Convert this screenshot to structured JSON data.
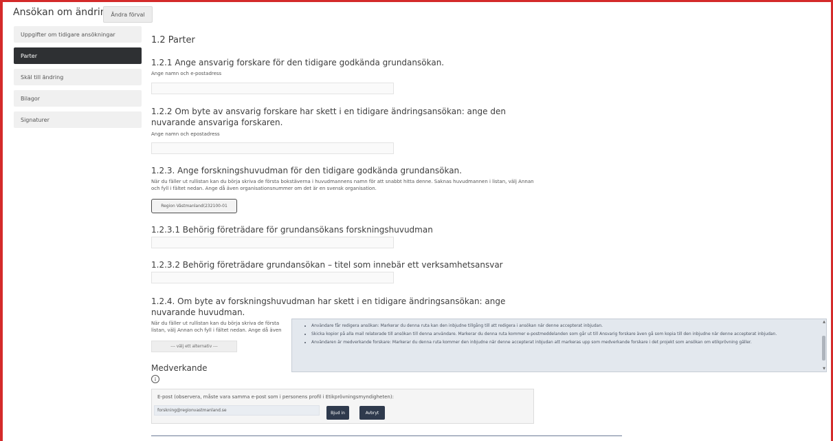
{
  "header": {
    "title": "Ansökan om ändring",
    "change_button": "Ändra förval"
  },
  "sidebar": {
    "items": [
      {
        "label": "Uppgifter om tidigare ansökningar"
      },
      {
        "label": "Parter"
      },
      {
        "label": "Skäl till ändring"
      },
      {
        "label": "Bilagor"
      },
      {
        "label": "Signaturer"
      }
    ],
    "active_index": 1
  },
  "main": {
    "section_title": "1.2 Parter",
    "q121": {
      "heading": "1.2.1 Ange ansvarig forskare för den tidigare godkända grundansökan.",
      "label": "Ange namn och e-postadress",
      "value": ""
    },
    "q122": {
      "heading": "1.2.2 Om byte av ansvarig forskare har skett i en tidigare ändringsansökan: ange den nuvarande ansvariga forskaren.",
      "label": "Ange namn och epostadress",
      "value": ""
    },
    "q123": {
      "heading": "1.2.3. Ange forskningshuvudman för den tidigare godkända grundansökan.",
      "help": "När du fäller ut rullistan kan du börja skriva de första bokstäverna i huvudmannens namn för att snabbt hitta denne. Saknas huvudmannen i listan, välj Annan och fyll i fältet nedan. Ange då även organisationsnummer om det är en svensk organisation.",
      "selected": "Region Västmanland(232100-01"
    },
    "q1231": {
      "heading": "1.2.3.1 Behörig företrädare för grundansökans forskningshuvudman",
      "value": ""
    },
    "q1232": {
      "heading": "1.2.3.2 Behörig företrädare grundansökan – titel som innebär ett verksamhetsansvar",
      "value": ""
    },
    "q124": {
      "heading": "1.2.4. Om byte av forskningshuvudman har skett i en tidigare ändringsansökan: ange nuvarande huvudman.",
      "help_line1": "När du fäller ut rullistan kan du börja skriva de första",
      "help_line2": "listan, välj Annan och fyll i fältet nedan. Ange då även",
      "select_placeholder": "--- välj ett alternativ ---"
    }
  },
  "tooltip": {
    "items": [
      "Användare får redigera ansökan: Markerar du denna ruta kan den inbjudne tillgång till att redigera i ansökan när denne accepterat inbjudan.",
      "Skicka kopior på alla mail relaterade till ansökan till denna användare. Markerar du denna ruta kommer e-postmeddelanden som går ut till Ansvarig forskare även gå som kopia till den inbjudne när denne accepterat inbjudan.",
      "Användaren är medverkande forskare: Markerar du denna ruta kommer den inbjudne när denne accepterat inbjudan att markeras upp som medverkande forskare i det projekt som ansökan om etikprövning gäller."
    ]
  },
  "medverkande": {
    "title": "Medverkande",
    "info_symbol": "i",
    "email_label": "E-post (observera, måste vara samma e-post som i personens profil i Etikprövningsmyndigheten):",
    "email_value": "forskning@regionvastmanland.se",
    "invite_button": "Bjud in",
    "cancel_button": "Avbryt"
  },
  "colors": {
    "active_sidebar": "#2e3033",
    "button_dark": "#2f3a4d",
    "tooltip_bg": "#e3e8ee",
    "frame": "#d42a2a"
  }
}
